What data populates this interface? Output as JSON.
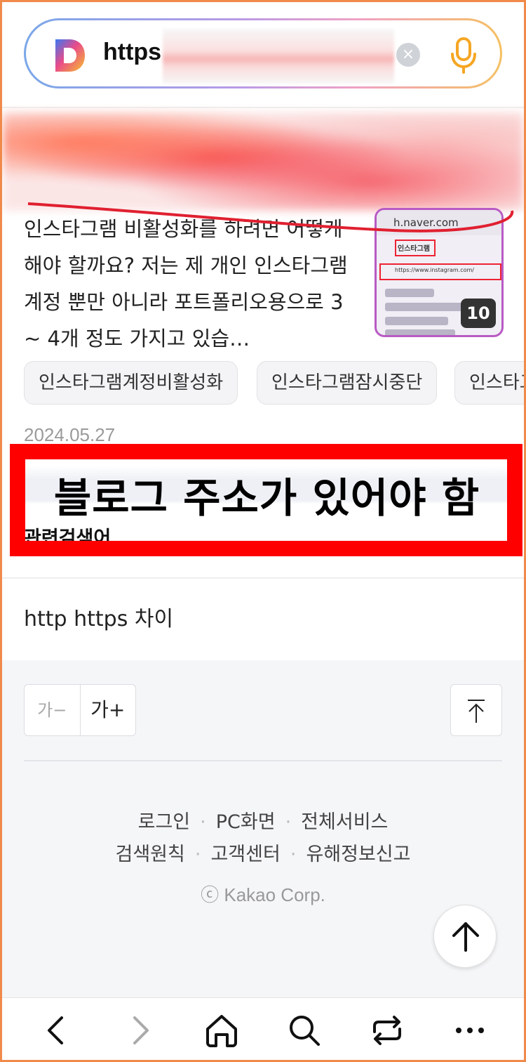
{
  "address_bar": {
    "url_text": "https",
    "clear_glyph": "×",
    "icons": [
      "daum-logo",
      "clear-icon",
      "mic-icon"
    ]
  },
  "result": {
    "snippet": "인스타그램 비활성화를 하려면 어떻게 해야 할까요? 저는 제 개인 인스타그램 계정 뿐만 아니라 포트폴리오용으로 3 ~ 4개 정도 가지고 있습…",
    "thumbnail": {
      "url_bar_text": "h.naver.com",
      "title_chip": "인스타그램",
      "link_text": "https://www.instagram.com/",
      "image_count": "10"
    },
    "tags": [
      "인스타그램계정비활성화",
      "인스타그램잠시중단",
      "인스타그"
    ],
    "date": "2024.05.27"
  },
  "callout": {
    "text": "블로그 주소가 있어야 함",
    "color": "#ff0000"
  },
  "related": {
    "heading": "관련검색어",
    "items": [
      "http https 차이"
    ]
  },
  "footer": {
    "font_smaller": "가−",
    "font_larger": "가+",
    "links_row1": [
      "로그인",
      "PC화면",
      "전체서비스"
    ],
    "links_row2": [
      "검색원칙",
      "고객센터",
      "유해정보신고"
    ],
    "copyright": "ⓒ Kakao Corp."
  },
  "bottom_nav": {
    "items": [
      "back-icon",
      "forward-icon",
      "home-icon",
      "search-icon",
      "tabs-icon",
      "more-icon"
    ]
  },
  "colors": {
    "frame": "#f08a4b",
    "accent_red": "#ff0000",
    "mic": "#f5a623"
  }
}
